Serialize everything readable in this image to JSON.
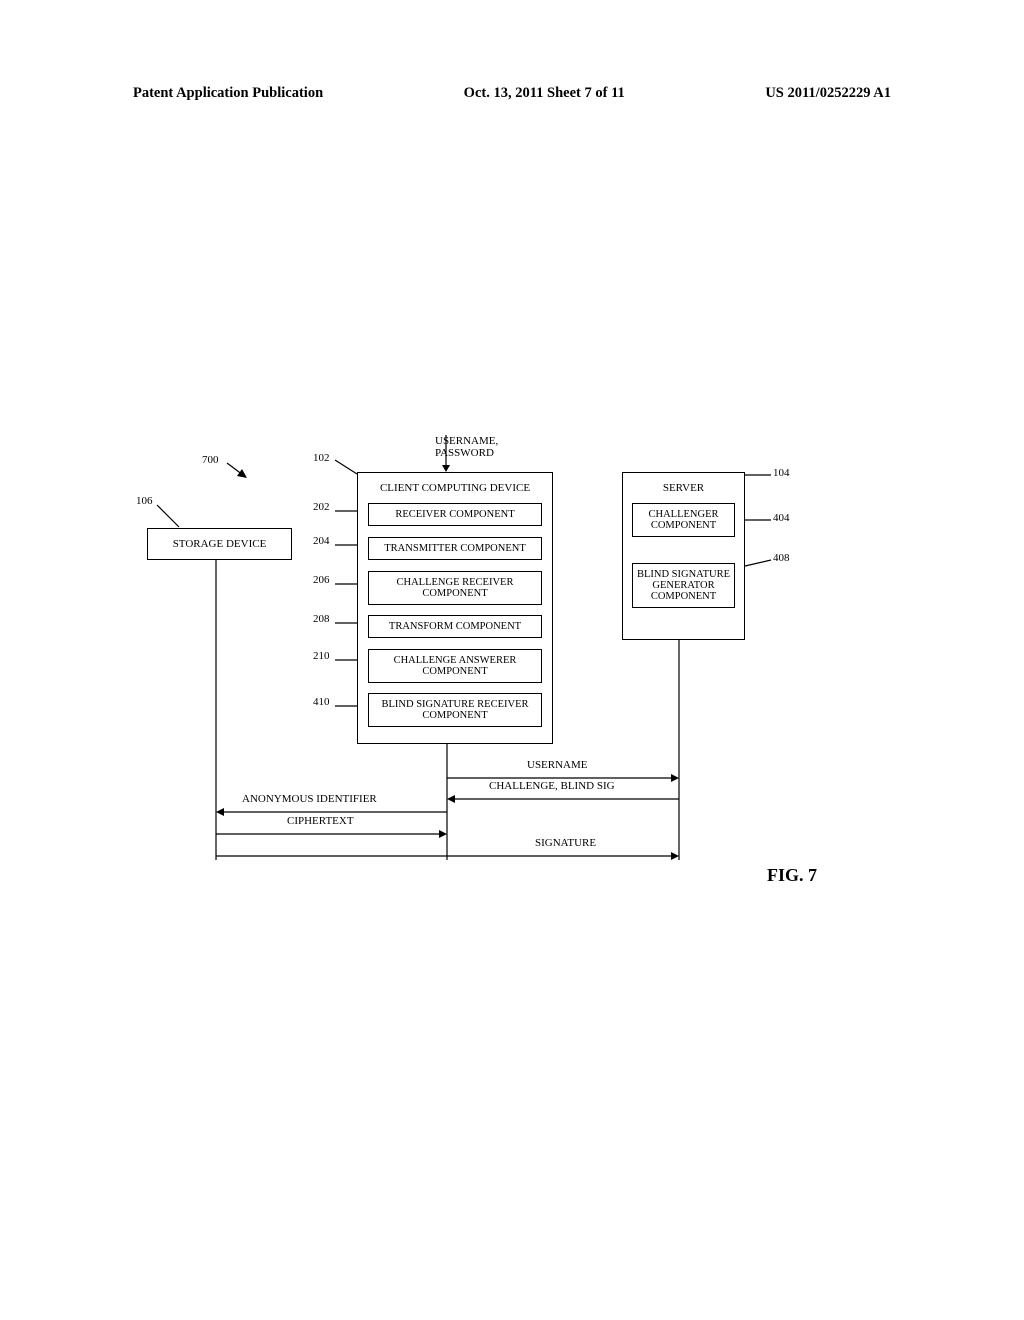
{
  "header": {
    "left": "Patent Application Publication",
    "middle": "Oct. 13, 2011   Sheet 7 of 11",
    "right": "US 2011/0252229 A1"
  },
  "refs": {
    "r700": "700",
    "r102": "102",
    "r104": "104",
    "r106": "106",
    "r202": "202",
    "r204": "204",
    "r206": "206",
    "r208": "208",
    "r210": "210",
    "r404": "404",
    "r408": "408",
    "r410": "410"
  },
  "input": {
    "line1": "USERNAME,",
    "line2": "PASSWORD"
  },
  "storage": {
    "label": "STORAGE DEVICE"
  },
  "client": {
    "title": "CLIENT COMPUTING DEVICE",
    "receiver": "RECEIVER COMPONENT",
    "transmitter": "TRANSMITTER COMPONENT",
    "challenge_receiver": "CHALLENGE RECEIVER COMPONENT",
    "transform": "TRANSFORM COMPONENT",
    "challenge_answerer": "CHALLENGE ANSWERER COMPONENT",
    "blind_sig_receiver": "BLIND SIGNATURE RECEIVER COMPONENT"
  },
  "server": {
    "title": "SERVER",
    "challenger": "CHALLENGER COMPONENT",
    "blind_sig_gen": "BLIND SIGNATURE GENERATOR COMPONENT"
  },
  "arrows": {
    "username": "USERNAME",
    "challenge": "CHALLENGE, BLIND SIG",
    "anon_id": "ANONYMOUS IDENTIFIER",
    "ciphertext": "CIPHERTEXT",
    "signature": "SIGNATURE"
  },
  "fig": "FIG. 7"
}
